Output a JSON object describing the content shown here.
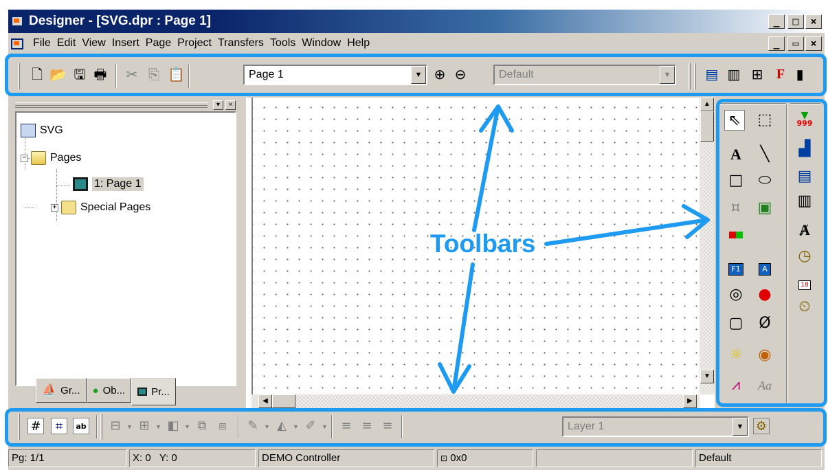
{
  "window": {
    "title": "Designer - [SVG.dpr : Page 1]",
    "controls": {
      "minimize": "_",
      "maximize": "□",
      "close": "×"
    }
  },
  "menu": {
    "items": [
      "File",
      "Edit",
      "View",
      "Insert",
      "Page",
      "Project",
      "Transfers",
      "Tools",
      "Window",
      "Help"
    ],
    "mdi_controls": {
      "minimize": "_",
      "restore": "▭",
      "close": "×"
    }
  },
  "toolbar": {
    "page_combo": "Page 1",
    "style_combo": "Default",
    "icons": [
      "new-icon",
      "open-icon",
      "save-icon",
      "print-icon",
      "cut-icon",
      "copy-icon",
      "paste-icon",
      "zoom-in-icon",
      "zoom-out-icon",
      "panel-icon",
      "grid-icon",
      "tree-icon",
      "font-icon"
    ]
  },
  "project_tree": {
    "root": "SVG",
    "pages_folder": "Pages",
    "page_item": "1: Page 1",
    "special_folder": "Special Pages"
  },
  "panel_tabs": [
    "Gr...",
    "Ob...",
    "Pr..."
  ],
  "bottom_toolbar": {
    "layer_combo": "Layer 1",
    "grid_text_icon": "ab"
  },
  "right_toolbar": {
    "counter_label": "999",
    "calendar_label": "18",
    "text_tool": "A",
    "font_tool": "Aa",
    "button_f1": "F1",
    "button_a": "A"
  },
  "status": {
    "page": "Pg: 1/1",
    "x": "X: 0",
    "y": "Y: 0",
    "controller": "DEMO Controller",
    "size": "0x0",
    "style": "Default"
  },
  "annotation": {
    "label": "Toolbars",
    "color": "#1e9bf0"
  }
}
